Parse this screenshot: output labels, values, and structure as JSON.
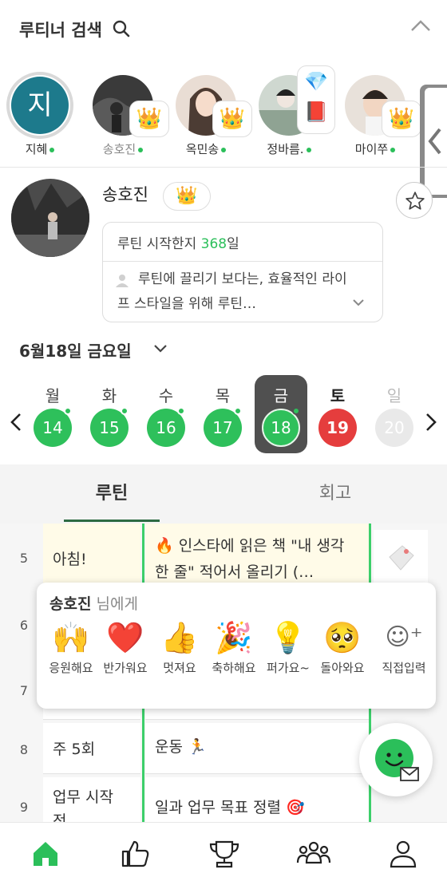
{
  "header": {
    "title": "루티너 검색"
  },
  "friends": [
    {
      "name": "지혜",
      "initial": "지",
      "online": true,
      "dim": false
    },
    {
      "name": "송호진",
      "online": true,
      "badge": "👑",
      "dim": true
    },
    {
      "name": "옥민송",
      "online": true,
      "badge": "👑",
      "dim": false
    },
    {
      "name": "정바름.",
      "online": true,
      "badge": "💎📕",
      "dim": false
    },
    {
      "name": "마이쭈",
      "online": true,
      "badge": "👑",
      "dim": false
    }
  ],
  "profile": {
    "name": "송호진",
    "crown": "👑",
    "days_prefix": "루틴 시작한지 ",
    "days": "368",
    "days_suffix": "일",
    "bio": "루틴에 끌리기 보다는, 효율적인 라이프 스타일을 위해 루틴…"
  },
  "date": {
    "title": "6월18일 금요일"
  },
  "week": [
    {
      "label": "월",
      "day": "14",
      "dot": true
    },
    {
      "label": "화",
      "day": "15",
      "dot": true
    },
    {
      "label": "수",
      "day": "16",
      "dot": true
    },
    {
      "label": "목",
      "day": "17",
      "dot": true
    },
    {
      "label": "금",
      "day": "18",
      "dot": true,
      "selected": true
    },
    {
      "label": "토",
      "day": "19",
      "dot": false
    },
    {
      "label": "일",
      "day": "20",
      "dot": false
    }
  ],
  "tabs": {
    "routine": "루틴",
    "review": "회고"
  },
  "rows": [
    {
      "num": "5",
      "time": "아침!",
      "task": "🔥 인스타에 읽은 책 \"내 생각 한 줄\" 적어서 올리기 (…"
    },
    {
      "num": "6",
      "time": "",
      "task": ""
    },
    {
      "num": "7",
      "time": "",
      "task": ""
    },
    {
      "num": "8",
      "time": "주 5회",
      "task": "운동 🏃"
    },
    {
      "num": "9",
      "time": "업무 시작 전",
      "task": "일과 업무 목표 정렬 🎯"
    }
  ],
  "popup": {
    "name": "송호진",
    "suffix": " 님에게",
    "reactions": [
      {
        "emoji": "🙌",
        "label": "응원해요"
      },
      {
        "emoji": "❤️",
        "label": "반가워요"
      },
      {
        "emoji": "👍",
        "label": "멋져요"
      },
      {
        "emoji": "🎉",
        "label": "축하해요"
      },
      {
        "emoji": "💡",
        "label": "퍼가요~"
      },
      {
        "emoji": "🥺",
        "label": "돌아와요"
      },
      {
        "emoji": "☺⁺",
        "label": "직접입력"
      }
    ]
  },
  "colors": {
    "accent": "#2ec05b",
    "sunday_red": "#e53d3d",
    "selected_day_bg": "#505050",
    "tab_underline": "#2d6b43"
  }
}
